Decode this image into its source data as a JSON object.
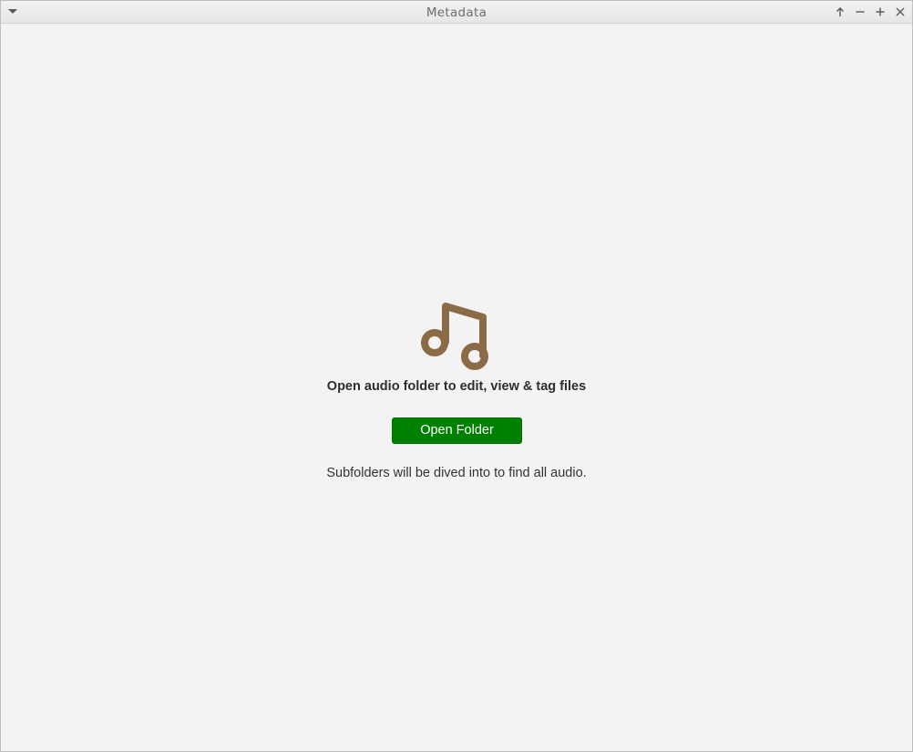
{
  "window": {
    "title": "Metadata",
    "controls": {
      "menu_icon": "chevron-down-icon",
      "keep_above_icon": "arrow-up-icon",
      "minimize_icon": "minimize-icon",
      "maximize_icon": "plus-icon",
      "close_icon": "close-icon"
    }
  },
  "main": {
    "icon": "music-note-icon",
    "icon_color": "#8b6a47",
    "heading": "Open audio folder to edit, view & tag files",
    "open_button_label": "Open Folder",
    "open_button_color": "#008000",
    "hint": "Subfolders will be dived into to find all audio."
  }
}
